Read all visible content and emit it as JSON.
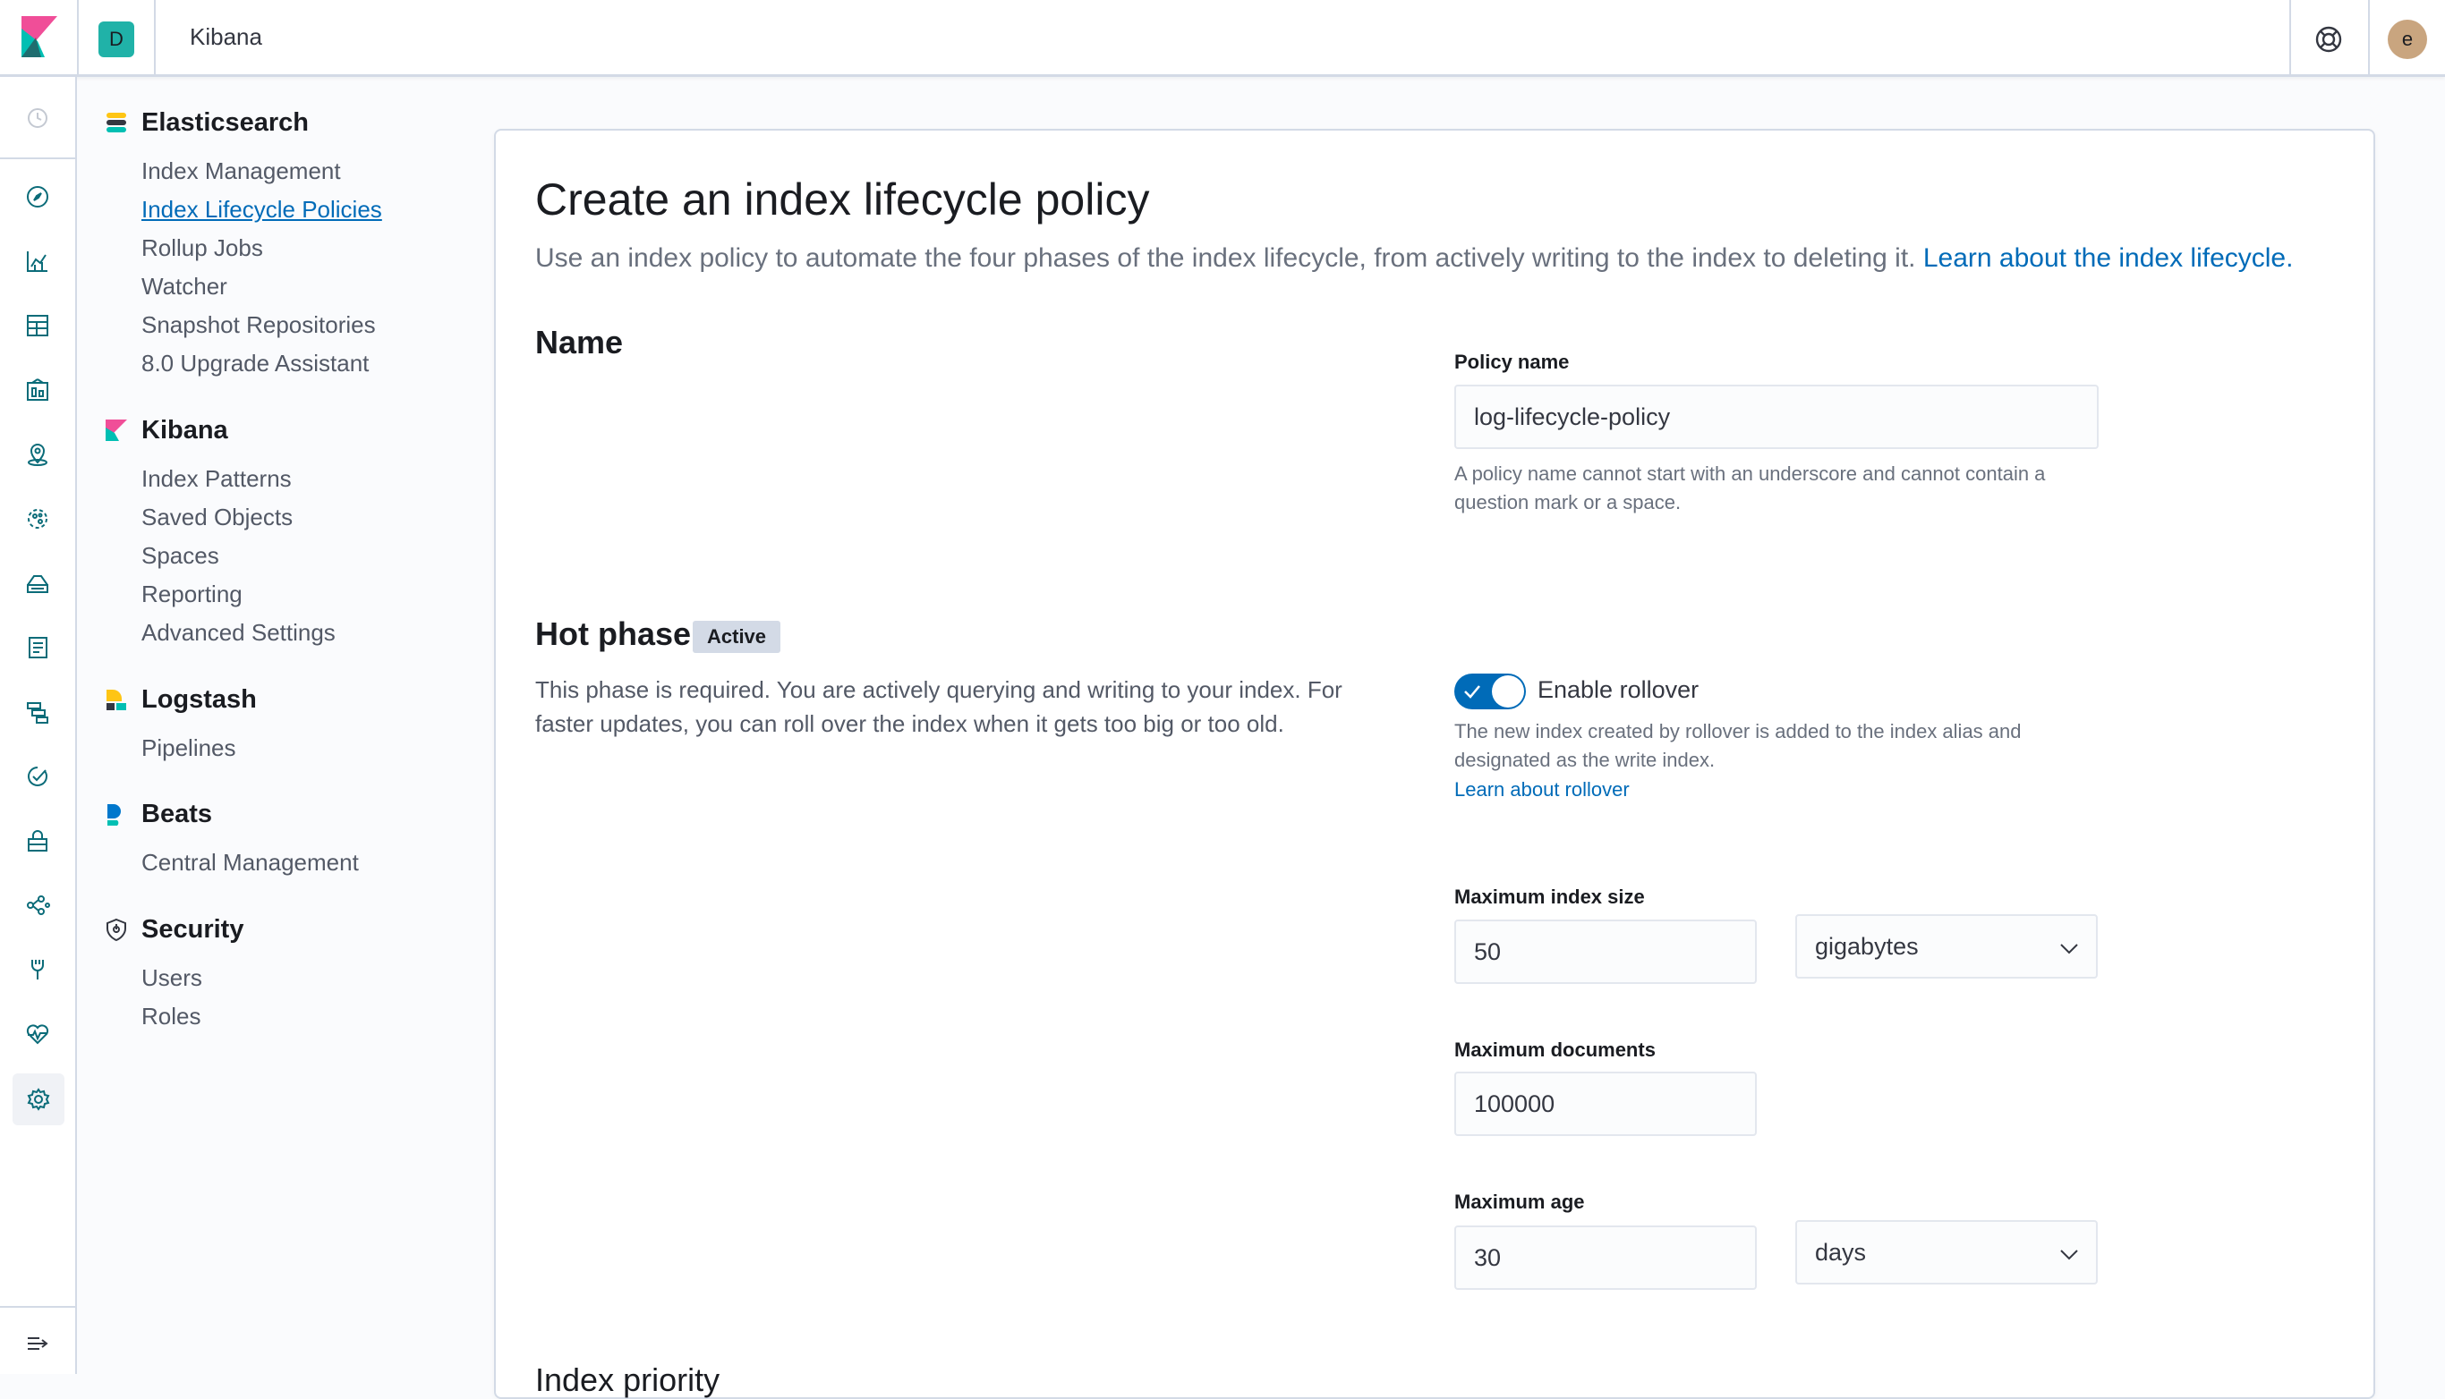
{
  "header": {
    "space_initial": "D",
    "app_title": "Kibana",
    "user_initial": "e"
  },
  "iconnav": {
    "icons": [
      "clock-icon",
      "discover-icon",
      "visualize-icon",
      "dashboard-icon",
      "canvas-icon",
      "maps-icon",
      "ml-icon",
      "infrastructure-icon",
      "logs-icon",
      "apm-icon",
      "uptime-icon",
      "siem-icon",
      "graph-icon",
      "dev-tools-icon",
      "monitoring-icon",
      "management-icon",
      "collapse-icon"
    ]
  },
  "sidemenu": {
    "sections": [
      {
        "title": "Elasticsearch",
        "items": [
          "Index Management",
          "Index Lifecycle Policies",
          "Rollup Jobs",
          "Watcher",
          "Snapshot Repositories",
          "8.0 Upgrade Assistant"
        ]
      },
      {
        "title": "Kibana",
        "items": [
          "Index Patterns",
          "Saved Objects",
          "Spaces",
          "Reporting",
          "Advanced Settings"
        ]
      },
      {
        "title": "Logstash",
        "items": [
          "Pipelines"
        ]
      },
      {
        "title": "Beats",
        "items": [
          "Central Management"
        ]
      },
      {
        "title": "Security",
        "items": [
          "Users",
          "Roles"
        ]
      }
    ],
    "active_item": "Index Lifecycle Policies"
  },
  "main": {
    "title": "Create an index lifecycle policy",
    "description": "Use an index policy to automate the four phases of the index lifecycle, from actively writing to the index to deleting it.",
    "description_link": "Learn about the index lifecycle.",
    "name_section": {
      "heading": "Name",
      "policy_label": "Policy name",
      "policy_value": "log-lifecycle-policy",
      "policy_help": "A policy name cannot start with an underscore and cannot contain a question mark or a space."
    },
    "hot_phase": {
      "heading": "Hot phase",
      "badge": "Active",
      "description": "This phase is required. You are actively querying and writing to your index. For faster updates, you can roll over the index when it gets too big or too old.",
      "rollover_enabled": true,
      "rollover_label": "Enable rollover",
      "rollover_help": "The new index created by rollover is added to the index alias and designated as the write index.",
      "rollover_link": "Learn about rollover",
      "max_size_label": "Maximum index size",
      "max_size_value": "50",
      "max_size_unit": "gigabytes",
      "max_docs_label": "Maximum documents",
      "max_docs_value": "100000",
      "max_age_label": "Maximum age",
      "max_age_value": "30",
      "max_age_unit": "days"
    },
    "next_section_heading": "Index priority"
  },
  "colors": {
    "accent": "#006bb8",
    "space_badge": "#20b2a8",
    "avatar": "#c9a57f"
  }
}
